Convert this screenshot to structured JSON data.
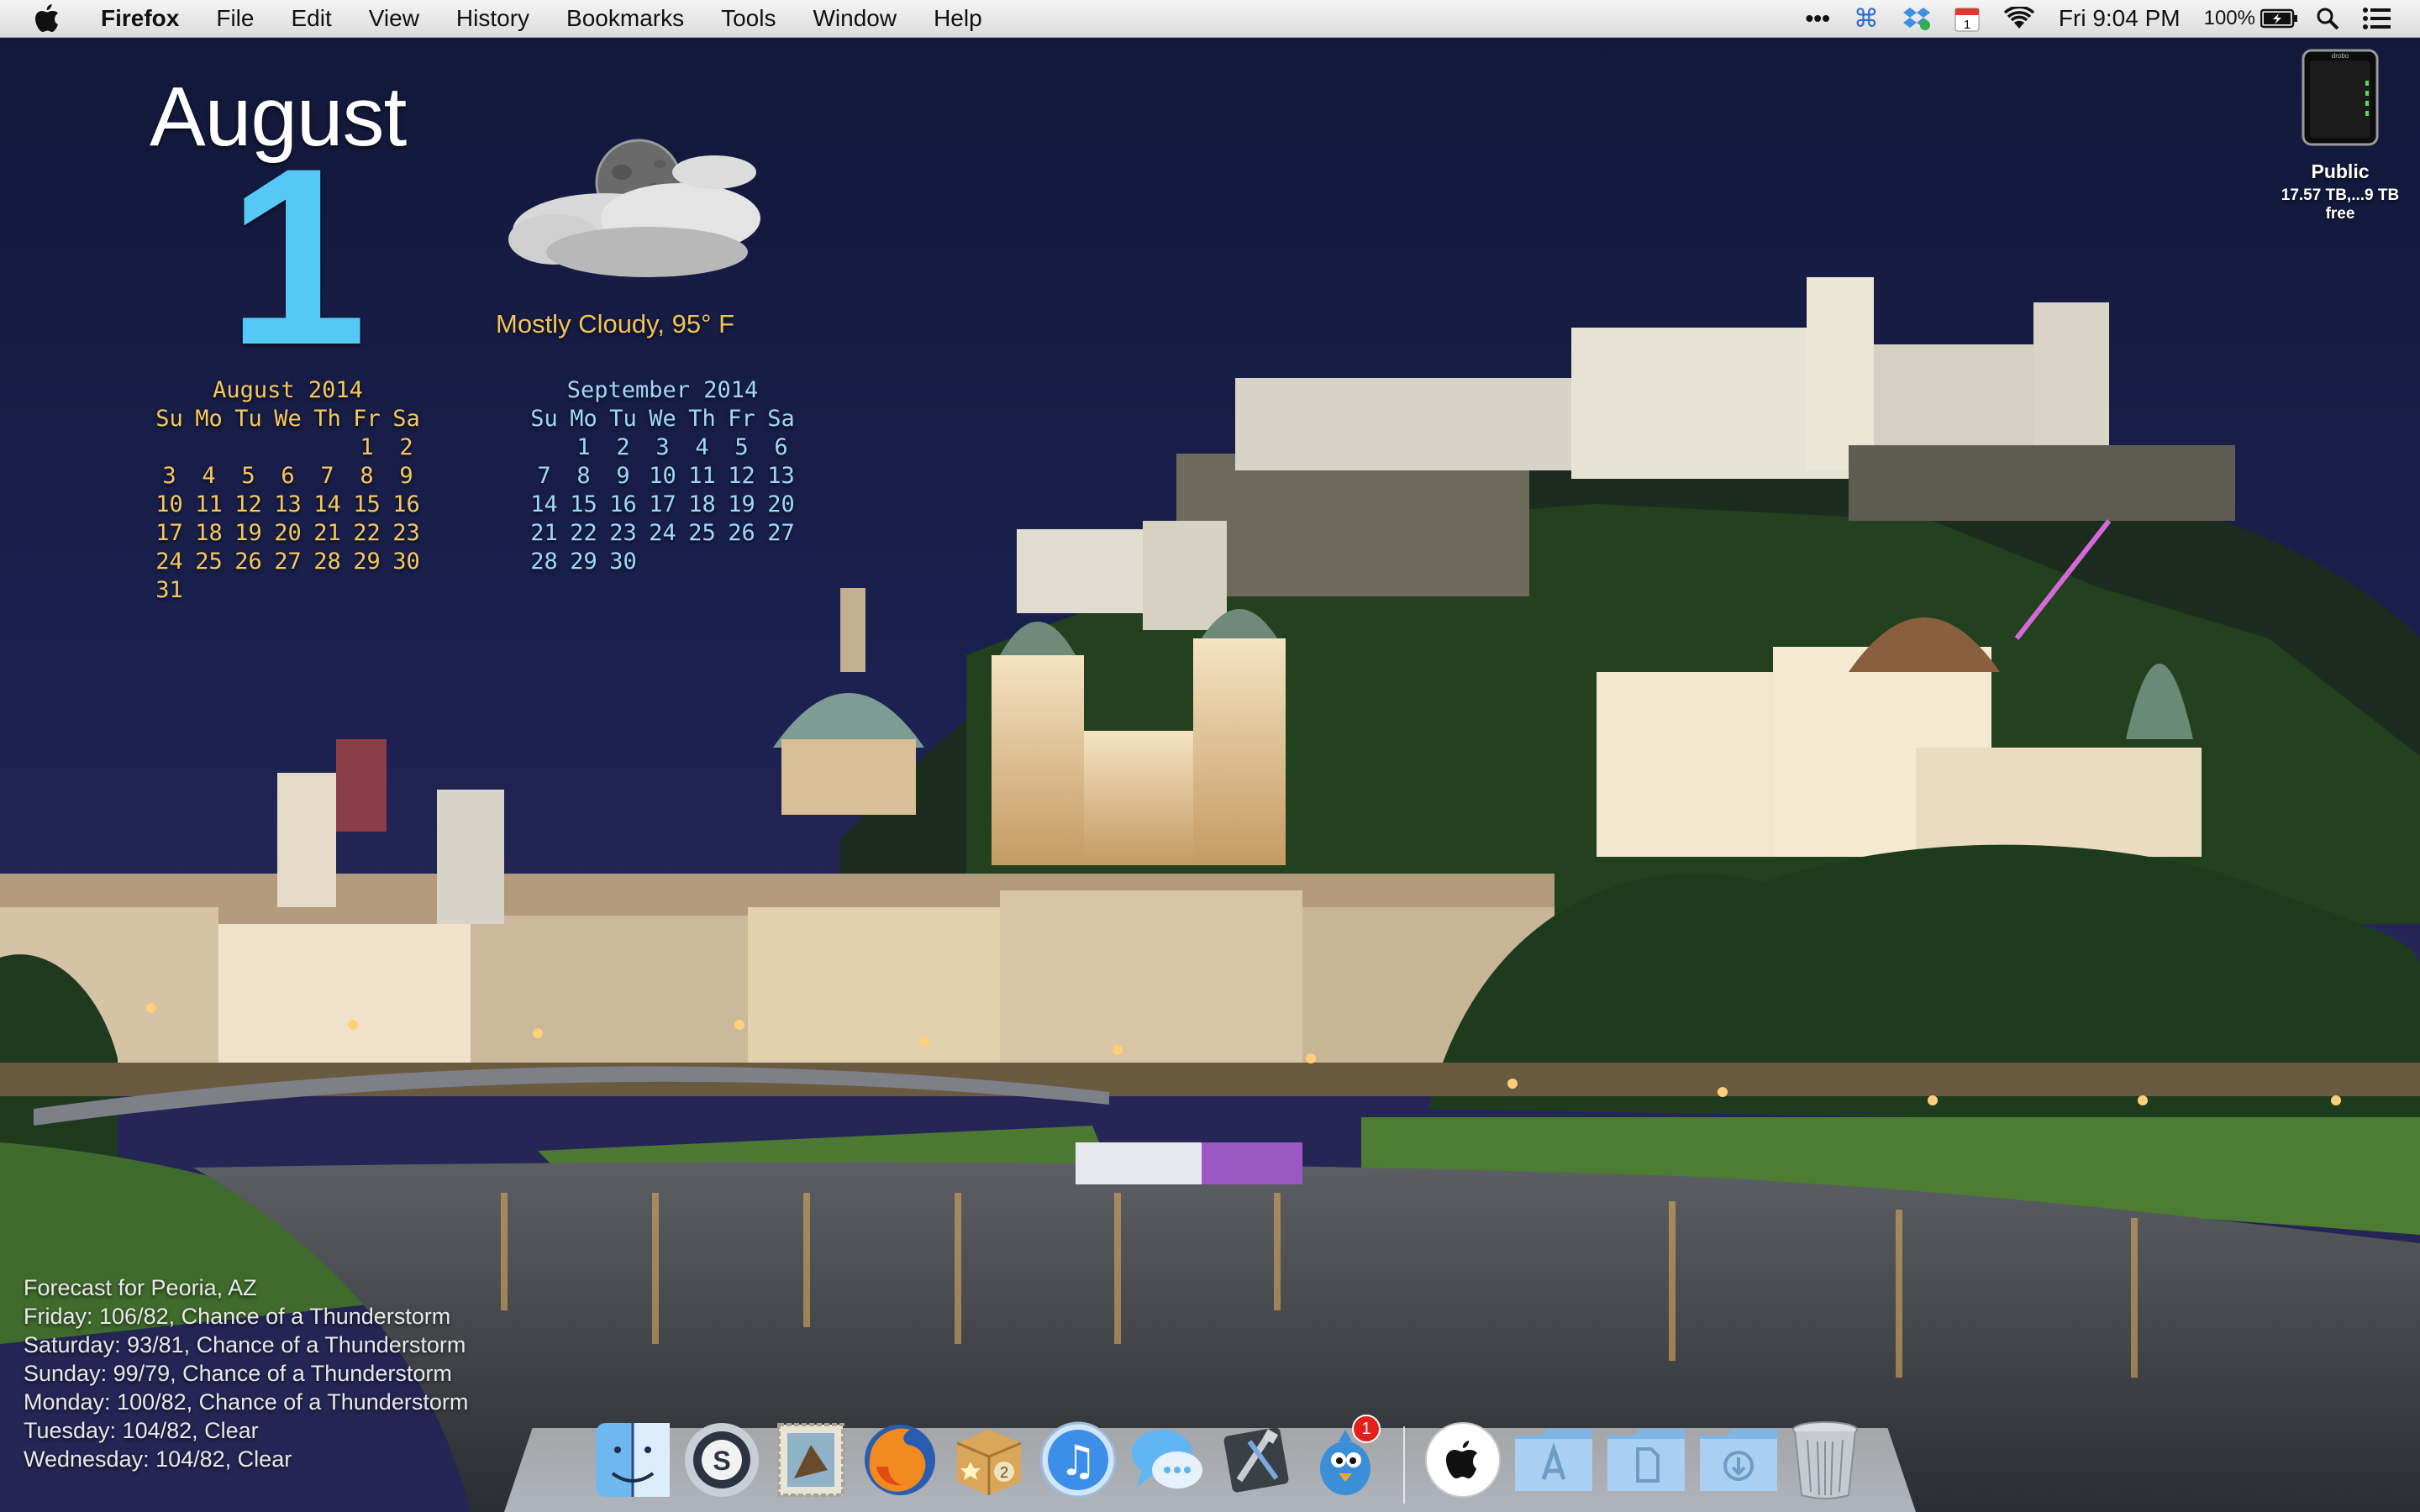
{
  "menubar": {
    "app_name": "Firefox",
    "items": [
      "File",
      "Edit",
      "View",
      "History",
      "Bookmarks",
      "Tools",
      "Window",
      "Help"
    ],
    "status": {
      "dots": "•••",
      "clock": "Fri 9:04 PM",
      "battery": "100%",
      "calendar_day": "1"
    }
  },
  "desktop": {
    "month": "August",
    "day": "1",
    "weather": "Mostly Cloudy, 95° F",
    "calendars": [
      {
        "title": "August 2014",
        "weekdays": [
          "Su",
          "Mo",
          "Tu",
          "We",
          "Th",
          "Fr",
          "Sa"
        ],
        "weeks": [
          [
            "",
            "",
            "",
            "",
            "",
            "1",
            "2"
          ],
          [
            "3",
            "4",
            "5",
            "6",
            "7",
            "8",
            "9"
          ],
          [
            "10",
            "11",
            "12",
            "13",
            "14",
            "15",
            "16"
          ],
          [
            "17",
            "18",
            "19",
            "20",
            "21",
            "22",
            "23"
          ],
          [
            "24",
            "25",
            "26",
            "27",
            "28",
            "29",
            "30"
          ],
          [
            "31",
            "",
            "",
            "",
            "",
            "",
            ""
          ]
        ]
      },
      {
        "title": "September 2014",
        "weekdays": [
          "Su",
          "Mo",
          "Tu",
          "We",
          "Th",
          "Fr",
          "Sa"
        ],
        "weeks": [
          [
            "",
            "1",
            "2",
            "3",
            "4",
            "5",
            "6"
          ],
          [
            "7",
            "8",
            "9",
            "10",
            "11",
            "12",
            "13"
          ],
          [
            "14",
            "15",
            "16",
            "17",
            "18",
            "19",
            "20"
          ],
          [
            "21",
            "22",
            "23",
            "24",
            "25",
            "26",
            "27"
          ],
          [
            "28",
            "29",
            "30",
            "",
            "",
            "",
            ""
          ]
        ]
      }
    ],
    "forecast": {
      "heading": "Forecast for Peoria, AZ",
      "lines": [
        "Friday: 106/82, Chance of a Thunderstorm",
        "Saturday: 93/81, Chance of a Thunderstorm",
        "Sunday: 99/79, Chance of a Thunderstorm",
        "Monday: 100/82, Chance of a Thunderstorm",
        "Tuesday: 104/82, Clear",
        "Wednesday: 104/82, Clear"
      ]
    },
    "drive": {
      "label": "Public",
      "detail": "17.57 TB,...9 TB free",
      "brand": "drobo"
    }
  },
  "dock": {
    "apps": [
      {
        "name": "finder-icon"
      },
      {
        "name": "1password-icon",
        "glyph": "S"
      },
      {
        "name": "mail-stamp-icon"
      },
      {
        "name": "firefox-icon"
      },
      {
        "name": "package-box-icon",
        "glyph": "2"
      },
      {
        "name": "itunes-icon",
        "glyph": "♫"
      },
      {
        "name": "messages-icon"
      },
      {
        "name": "xcode-icon"
      },
      {
        "name": "tweetbot-icon",
        "badge": "1"
      }
    ],
    "folders": [
      {
        "name": "apple-logo-icon"
      },
      {
        "name": "applications-folder-icon"
      },
      {
        "name": "documents-folder-icon"
      },
      {
        "name": "downloads-folder-icon"
      },
      {
        "name": "trash-icon"
      }
    ]
  },
  "colors": {
    "day_blue": "#55c8f8",
    "august_yellow": "#f6c85c",
    "september_blue": "#9fd8f8",
    "night_sky": "#151a3c"
  }
}
